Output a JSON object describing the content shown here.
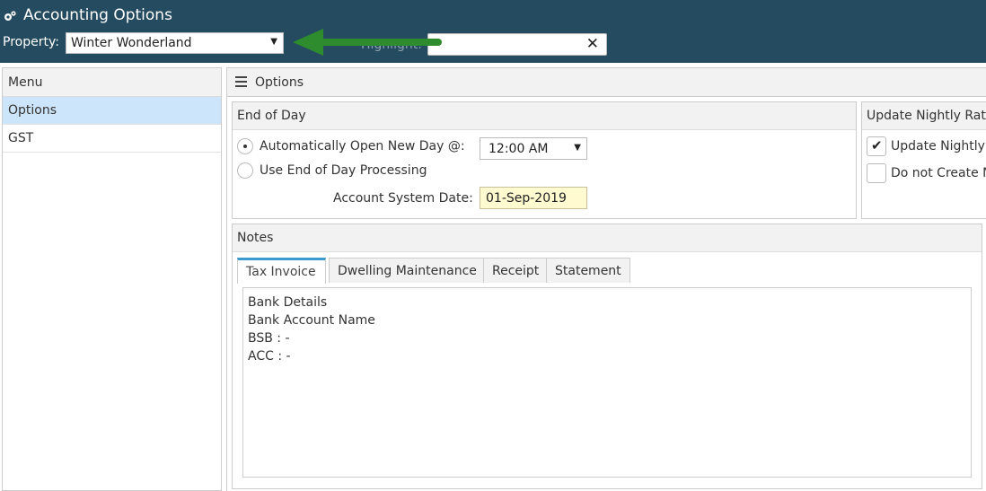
{
  "header": {
    "title": "Accounting Options",
    "property_label": "Property:",
    "property_value": "Winter Wonderland",
    "highlight_label": "Highlight:",
    "highlight_value": ""
  },
  "menu": {
    "title": "Menu",
    "items": [
      {
        "label": "Options",
        "active": true
      },
      {
        "label": "GST",
        "active": false
      }
    ]
  },
  "main": {
    "title": "Options"
  },
  "end_of_day": {
    "title": "End of Day",
    "auto_open_label": "Automatically Open New Day @:",
    "auto_open_selected": true,
    "time_value": "12:00 AM",
    "eod_processing_label": "Use End of Day Processing",
    "account_date_label": "Account System Date:",
    "account_date_value": "01-Sep-2019"
  },
  "update_nightly": {
    "title": "Update Nightly Rat",
    "update_label": "Update Nightly",
    "update_checked": true,
    "no_create_label": "Do not Create N",
    "no_create_checked": false
  },
  "notes": {
    "title": "Notes",
    "tabs": [
      {
        "label": "Tax Invoice",
        "active": true
      },
      {
        "label": "Dwelling Maintenance",
        "active": false
      },
      {
        "label": "Receipt",
        "active": false
      },
      {
        "label": "Statement",
        "active": false
      }
    ],
    "lines": [
      "Bank Details",
      "Bank Account Name",
      "BSB : -",
      "ACC : -"
    ]
  },
  "colors": {
    "header_bg": "#254b60",
    "menu_active_bg": "#cce5fa",
    "arrow": "#2e8b2e",
    "tab_accent": "#3b9bcf",
    "date_field_bg": "#fffad0"
  }
}
